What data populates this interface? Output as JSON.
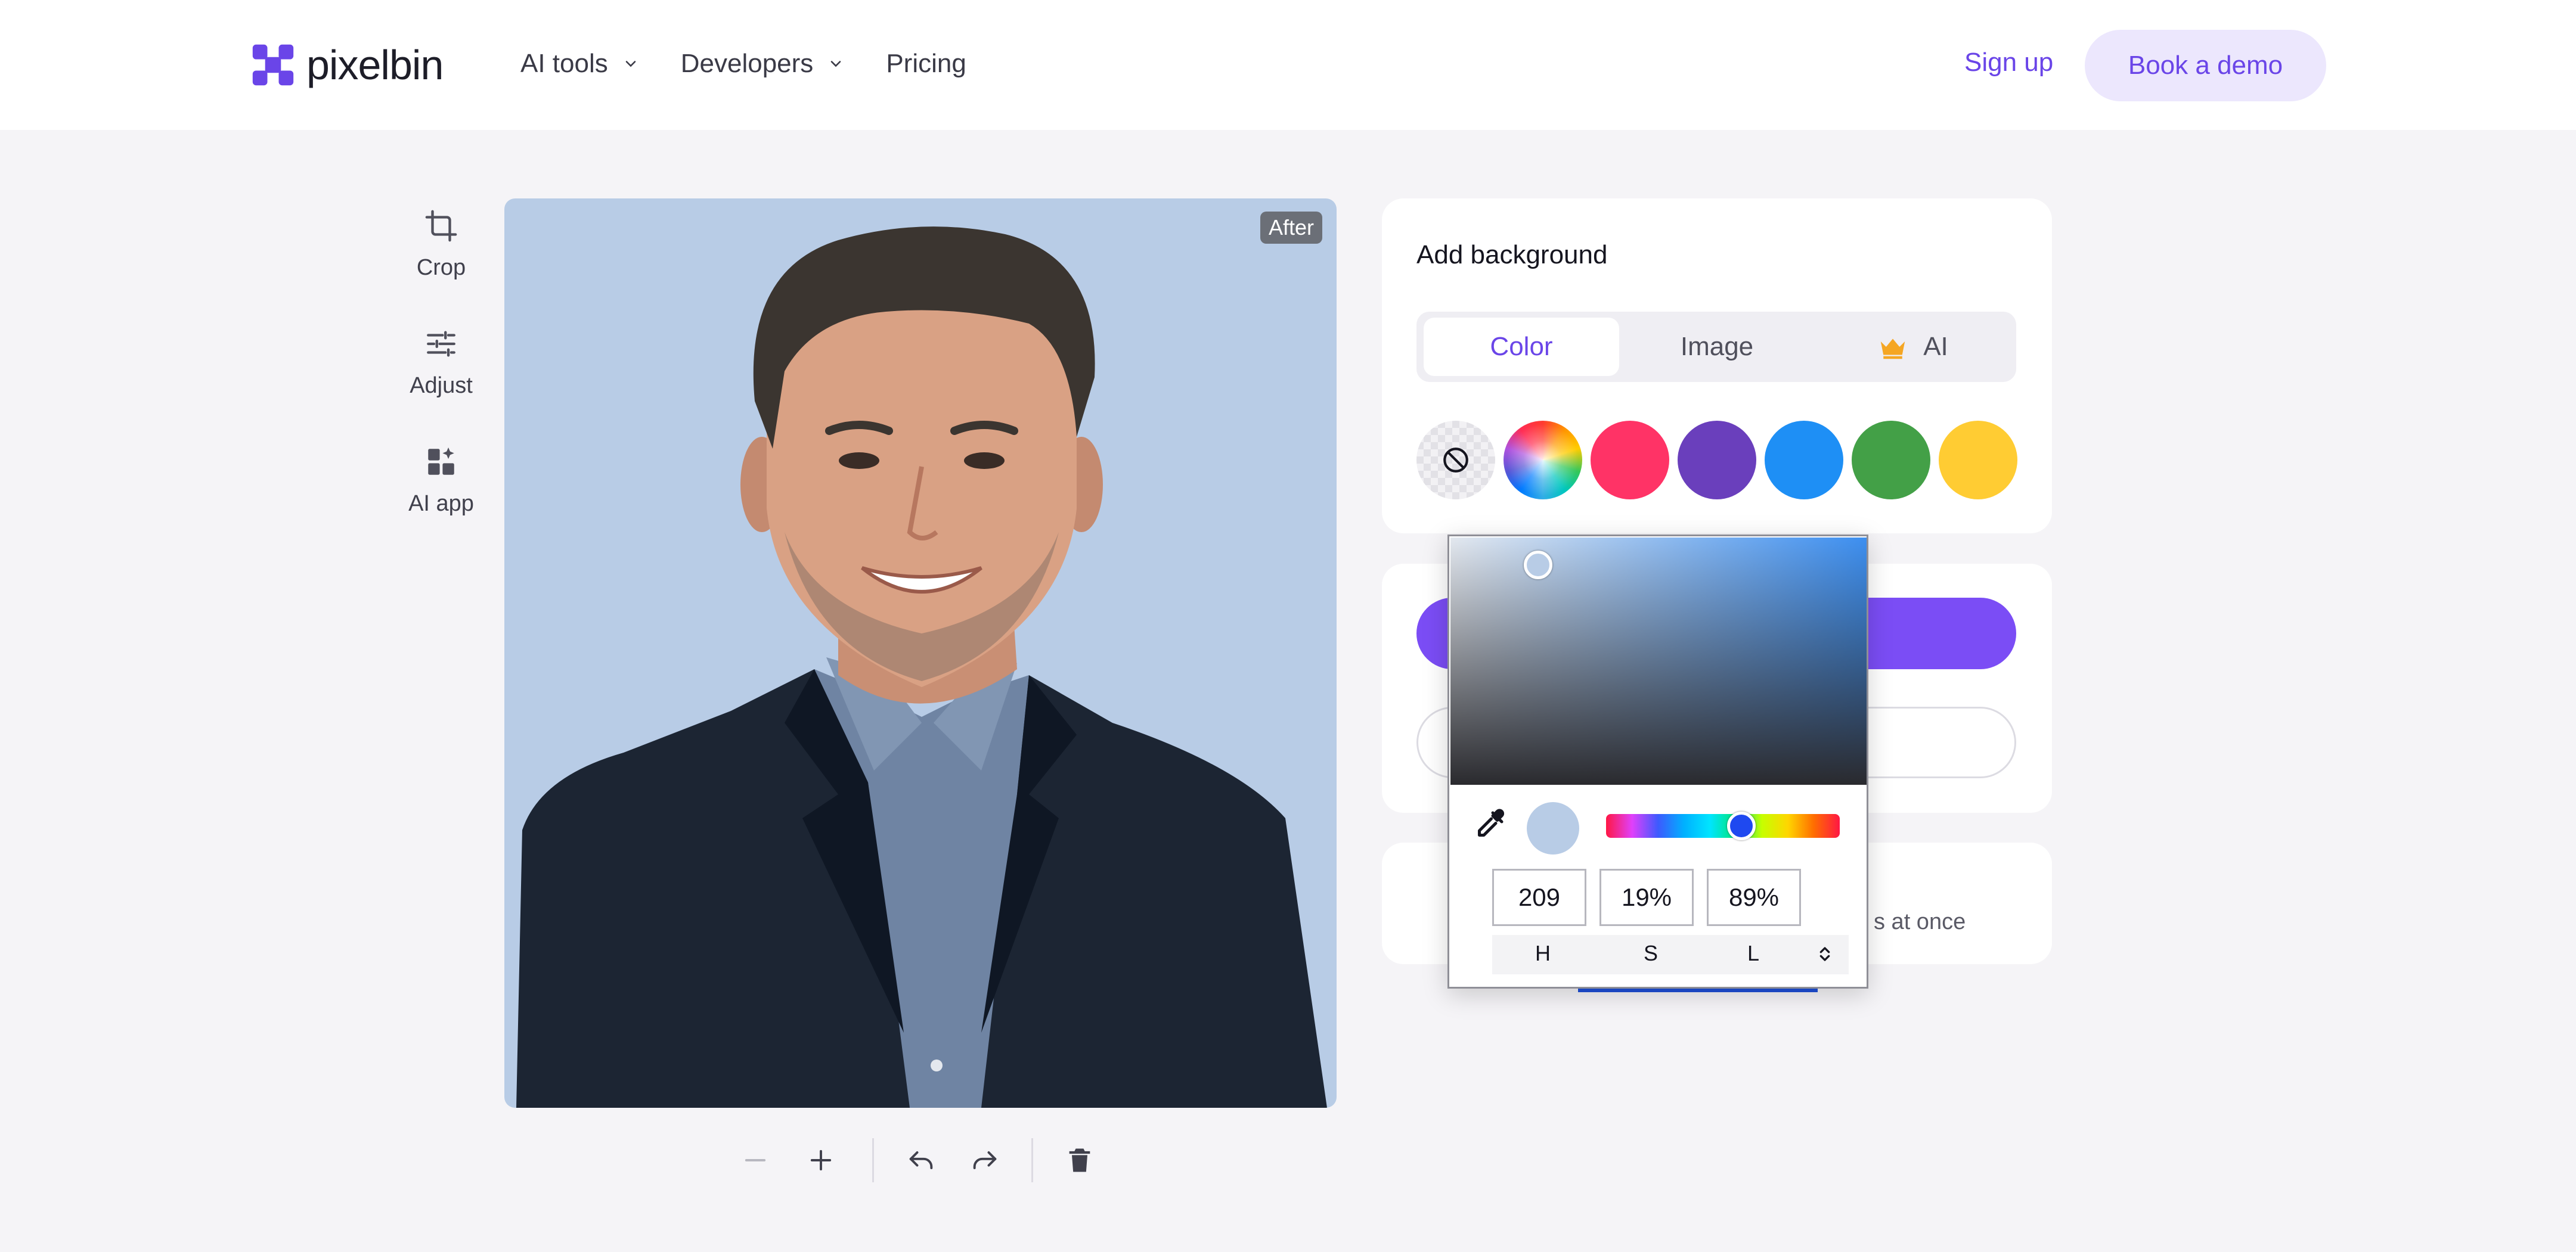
{
  "header": {
    "logo_text": "pixelbin",
    "nav": [
      {
        "label": "AI tools"
      },
      {
        "label": "Developers"
      },
      {
        "label": "Pricing"
      }
    ],
    "signup_label": "Sign up",
    "demo_label": "Book a demo"
  },
  "tools": [
    {
      "label": "Crop",
      "icon": "crop-icon"
    },
    {
      "label": "Adjust",
      "icon": "sliders-icon"
    },
    {
      "label": "AI app",
      "icon": "apps-icon"
    }
  ],
  "preview": {
    "badge": "After",
    "background_color": "#b8cce6"
  },
  "background_panel": {
    "title": "Add background",
    "tabs": [
      {
        "label": "Color",
        "active": true
      },
      {
        "label": "Image",
        "active": false
      },
      {
        "label": "AI",
        "active": false
      }
    ],
    "swatches": [
      "none",
      "rainbow",
      "#ff3366",
      "#6a3fbc",
      "#1e8ff5",
      "#43a047",
      "#ffcc33"
    ]
  },
  "card3": {
    "text_fragment": "s at once"
  },
  "color_picker": {
    "h": "209",
    "s": "19%",
    "l": "89%",
    "labels": [
      "H",
      "S",
      "L"
    ],
    "hue_fraction": 0.58,
    "preview_color": "#b8cce6"
  },
  "colors": {
    "accent": "#6a45e8",
    "primary_button": "#7b4df5",
    "logo": "#6a45e8"
  }
}
